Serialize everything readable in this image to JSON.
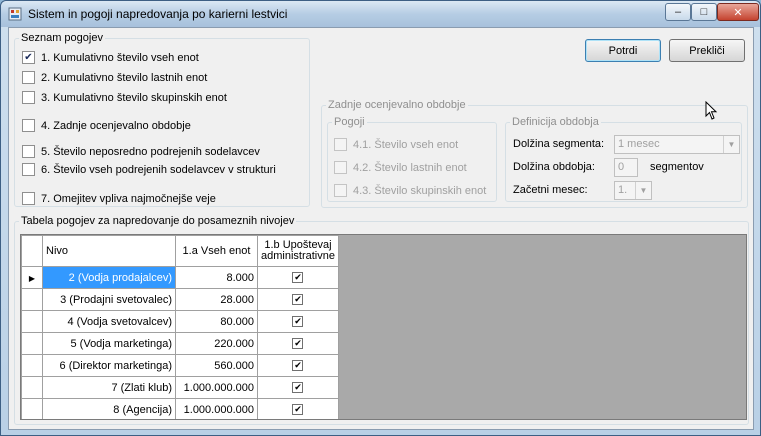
{
  "window": {
    "title": "Sistem in pogoji napredovanja po karierni lestvici",
    "minimize_label": "–",
    "maximize_label": "□",
    "close_label": "✕"
  },
  "conditions": {
    "legend": "Seznam pogojev",
    "items": [
      {
        "label": "1. Kumulativno število vseh enot",
        "checked": true
      },
      {
        "label": "2. Kumulativno število lastnih enot",
        "checked": false
      },
      {
        "label": "3. Kumulativno število skupinskih enot",
        "checked": false
      },
      {
        "label": "4. Zadnje ocenjevalno obdobje",
        "checked": false
      },
      {
        "label": "5. Število neposredno podrejenih sodelavcev",
        "checked": false
      },
      {
        "label": "6. Število vseh podrejenih sodelavcev v strukturi",
        "checked": false
      },
      {
        "label": "7. Omejitev vpliva najmočnejše veje",
        "checked": false
      }
    ]
  },
  "actions": {
    "confirm_label": "Potrdi",
    "cancel_label": "Prekliči"
  },
  "last_period": {
    "legend": "Zadnje ocenjevalno obdobje",
    "conditions_legend": "Pogoji",
    "conditions": [
      {
        "label": "4.1. Število vseh enot",
        "checked": false
      },
      {
        "label": "4.2. Število lastnih enot",
        "checked": false
      },
      {
        "label": "4.3. Število skupinskih enot",
        "checked": false
      }
    ],
    "definition": {
      "legend": "Definicija obdobja",
      "segment_length_label": "Dolžina segmenta:",
      "segment_length_value": "1 mesec",
      "period_length_label": "Dolžina obdobja:",
      "period_length_value": "0",
      "period_length_unit": "segmentov",
      "start_month_label": "Začetni mesec:",
      "start_month_value": "1."
    }
  },
  "table": {
    "legend": "Tabela pogojev za napredovanje do posameznih nivojev",
    "headers": {
      "nivo": "Nivo",
      "vseh_enot": "1.a Vseh enot",
      "upostevaj_line1": "1.b Upoštevaj",
      "upostevaj_line2": "administrativne"
    },
    "rows": [
      {
        "nivo": "2 (Vodja prodajalcev)",
        "vseh_enot": "8.000",
        "upostevaj": true,
        "selected": true
      },
      {
        "nivo": "3 (Prodajni svetovalec)",
        "vseh_enot": "28.000",
        "upostevaj": true,
        "selected": false
      },
      {
        "nivo": "4 (Vodja svetovalcev)",
        "vseh_enot": "80.000",
        "upostevaj": true,
        "selected": false
      },
      {
        "nivo": "5 (Vodja marketinga)",
        "vseh_enot": "220.000",
        "upostevaj": true,
        "selected": false
      },
      {
        "nivo": "6 (Direktor marketinga)",
        "vseh_enot": "560.000",
        "upostevaj": true,
        "selected": false
      },
      {
        "nivo": "7 (Zlati klub)",
        "vseh_enot": "1.000.000.000",
        "upostevaj": true,
        "selected": false
      },
      {
        "nivo": "8 (Agencija)",
        "vseh_enot": "1.000.000.000",
        "upostevaj": true,
        "selected": false
      }
    ],
    "current_row_marker": "▶"
  }
}
